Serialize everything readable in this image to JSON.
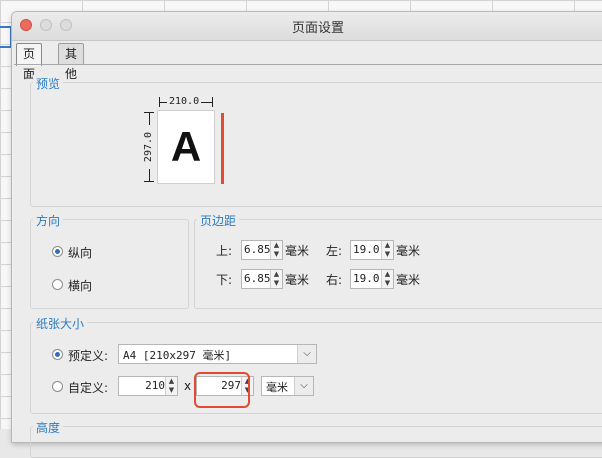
{
  "window": {
    "title": "页面设置"
  },
  "tabs": [
    {
      "label": "页面"
    },
    {
      "label": "其他"
    }
  ],
  "preview": {
    "title": "预览",
    "width_label": "210.0",
    "height_label": "297.0",
    "sample_letter": "A"
  },
  "orientation": {
    "title": "方向",
    "portrait_label": "纵向",
    "landscape_label": "横向",
    "selected": "portrait"
  },
  "margins": {
    "title": "页边距",
    "top_label": "上:",
    "top_value": "6.85",
    "top_unit": "毫米",
    "left_label": "左:",
    "left_value": "19.0",
    "left_unit": "毫米",
    "bottom_label": "下:",
    "bottom_value": "6.85",
    "bottom_unit": "毫米",
    "right_label": "右:",
    "right_value": "19.0",
    "right_unit": "毫米"
  },
  "paper_size": {
    "title": "纸张大小",
    "predefined_label": "预定义:",
    "predefined_value": "A4 [210x297 毫米]",
    "custom_label": "自定义:",
    "width_value": "210",
    "times": "x",
    "height_value": "297",
    "unit_value": "毫米",
    "selected": "predefined"
  },
  "height_section": {
    "title": "高度"
  },
  "colors": {
    "accent": "#2b7bc0",
    "highlight": "#e14b32",
    "close_button": "#ed6a5e"
  }
}
